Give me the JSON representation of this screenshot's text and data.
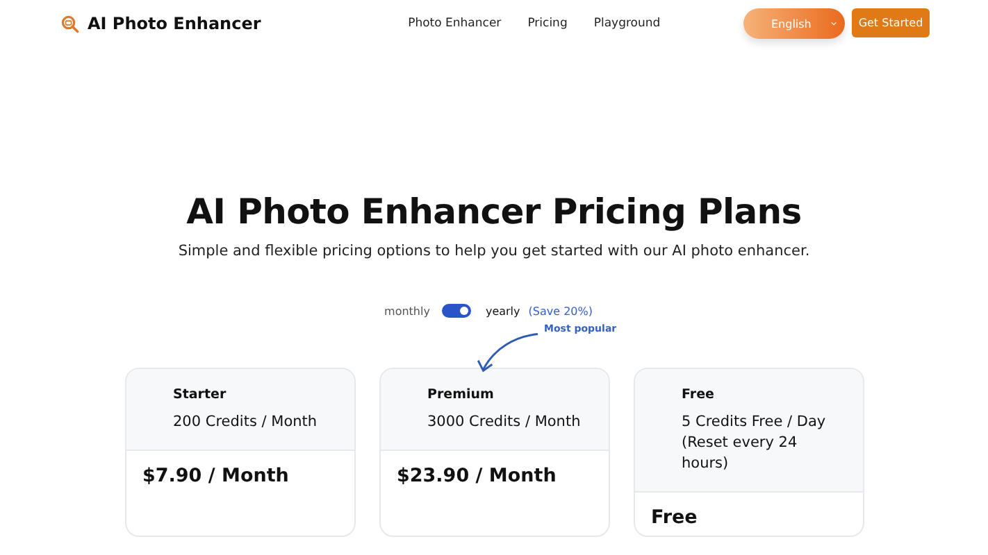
{
  "header": {
    "brand": "AI Photo Enhancer",
    "nav": [
      "Photo Enhancer",
      "Pricing",
      "Playground"
    ],
    "language": "English",
    "cta": "Get Started"
  },
  "hero": {
    "title": "AI Photo Enhancer Pricing Plans",
    "subtitle": "Simple and flexible pricing options to help you get started with our AI photo enhancer."
  },
  "billing": {
    "left_label": "monthly",
    "right_label": "yearly",
    "on": true,
    "note": "(Save 20%)"
  },
  "plans": [
    {
      "name": "Starter",
      "credits": "200 Credits / Month",
      "price": "$7.90 / Month"
    },
    {
      "name": "Premium",
      "credits": "3000 Credits / Month",
      "price": "$23.90 / Month",
      "badge": "Most popular"
    },
    {
      "name": "Free",
      "credits": "5 Credits Free / Day (Reset every 24 hours)",
      "price": "Free"
    }
  ]
}
